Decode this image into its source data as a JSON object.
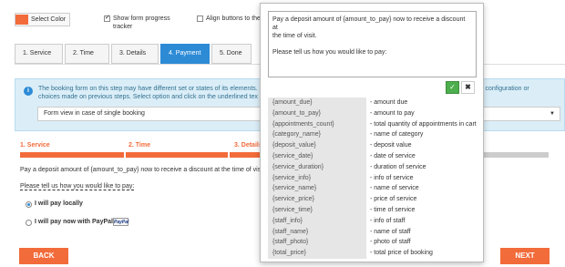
{
  "header": {
    "select_color_label": "Select Color",
    "show_progress_label_1": "Show form progress",
    "show_progress_label_2": "tracker",
    "align_buttons_label": "Align buttons to the",
    "accent_color": "#f26b3a"
  },
  "tabs": [
    {
      "label": "1. Service"
    },
    {
      "label": "2. Time"
    },
    {
      "label": "3. Details"
    },
    {
      "label": "4. Payment"
    },
    {
      "label": "5. Done"
    }
  ],
  "info": {
    "text_left": "The booking form on this step may have different set or states of its elements. choices made on previous steps. Select option and click on the underlined tex",
    "text_right": "s configuration or",
    "select_value": "Form view in case of single booking"
  },
  "progress": {
    "steps": [
      {
        "label": "1. Service"
      },
      {
        "label": "2. Time"
      },
      {
        "label": "3. Details"
      }
    ]
  },
  "main": {
    "deposit_text": "Pay a deposit amount of {amount_to_pay} now to receive a discount at the time of visit.",
    "pay_prompt": "Please tell us how you would like to pay:",
    "option_local": "I will pay locally",
    "option_paypal": "I will pay now with PayPal",
    "paypal_badge": "PayPal",
    "back_label": "BACK",
    "next_label": "NEXT"
  },
  "popup": {
    "textarea_value": "Pay a deposit amount of {amount_to_pay} now to receive a discount at\nthe time of visit.\n\nPlease tell us how you would like to pay:",
    "ok_label": "✓",
    "close_label": "✖",
    "codes": [
      {
        "code": "{amount_due}",
        "desc": "- amount due"
      },
      {
        "code": "{amount_to_pay}",
        "desc": "- amount to pay"
      },
      {
        "code": "{appointments_count}",
        "desc": "- total quantity of appointments in cart"
      },
      {
        "code": "{category_name}",
        "desc": "- name of category"
      },
      {
        "code": "{deposit_value}",
        "desc": "- deposit value"
      },
      {
        "code": "{service_date}",
        "desc": "- date of service"
      },
      {
        "code": "{service_duration}",
        "desc": "- duration of service"
      },
      {
        "code": "{service_info}",
        "desc": "- info of service"
      },
      {
        "code": "{service_name}",
        "desc": "- name of service"
      },
      {
        "code": "{service_price}",
        "desc": "- price of service"
      },
      {
        "code": "{service_time}",
        "desc": "- time of service"
      },
      {
        "code": "{staff_info}",
        "desc": "- info of staff"
      },
      {
        "code": "{staff_name}",
        "desc": "- name of staff"
      },
      {
        "code": "{staff_photo}",
        "desc": "- photo of staff"
      },
      {
        "code": "{total_price}",
        "desc": "- total price of booking"
      }
    ]
  }
}
